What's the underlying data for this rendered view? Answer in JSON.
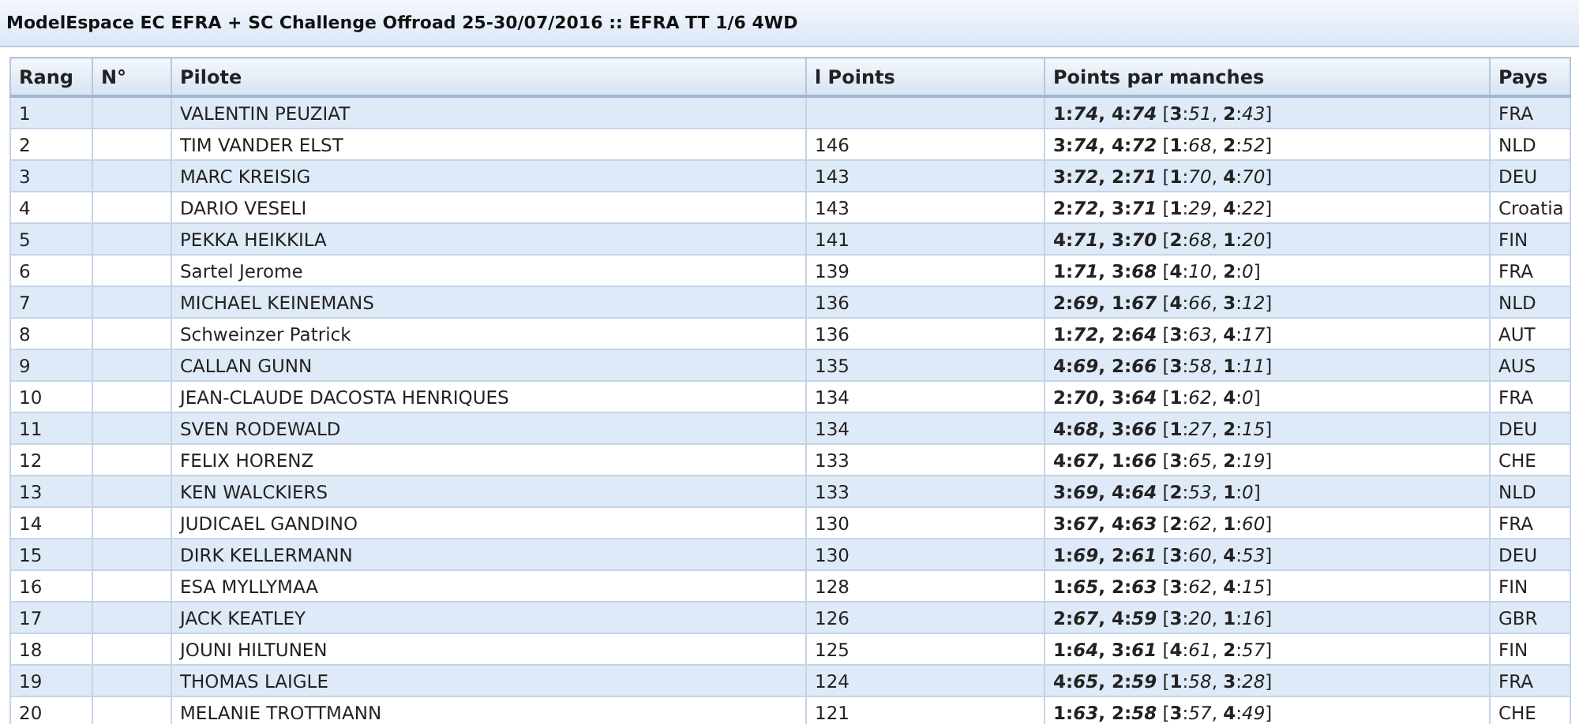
{
  "title": "ModelEspace EC EFRA + SC Challenge Offroad 25-30/07/2016 :: EFRA TT 1/6 4WD",
  "table": {
    "columns": [
      "Rang",
      "N°",
      "Pilote",
      "l Points",
      "Points par manches",
      "Pays"
    ],
    "rows": [
      {
        "rang": "1",
        "pilote": "VALENTIN PEUZIAT",
        "best": "1:*74*, 4:*74*",
        "dropped": "[**3**:*51*, **2**:*43*]",
        "pays": "FRA"
      },
      {
        "rang": "2",
        "pilote": "TIM VANDER ELST",
        "points": "146",
        "best": "3:*74*, 4:*72*",
        "dropped": "[**1**:*68*, **2**:*52*]",
        "pays": "NLD"
      },
      {
        "rang": "3",
        "pilote": "MARC KREISIG",
        "points": "143",
        "best": "3:*72*, 2:*71*",
        "dropped": "[**1**:*70*, **4**:*70*]",
        "pays": "DEU"
      },
      {
        "rang": "4",
        "pilote": "DARIO VESELI",
        "points": "143",
        "best": "2:*72*, 3:*71*",
        "dropped": "[**1**:*29*, **4**:*22*]",
        "pays": "Croatia"
      },
      {
        "rang": "5",
        "pilote": "PEKKA HEIKKILA",
        "points": "141",
        "best": "4:*71*, 3:*70*",
        "dropped": "[**2**:*68*, **1**:*20*]",
        "pays": "FIN"
      },
      {
        "rang": "6",
        "pilote": "Sartel Jerome",
        "points": "139",
        "best": "1:*71*, 3:*68*",
        "dropped": "[**4**:*10*, **2**:*0*]",
        "pays": "FRA"
      },
      {
        "rang": "7",
        "pilote": "MICHAEL KEINEMANS",
        "points": "136",
        "best": "2:*69*, 1:*67*",
        "dropped": "[**4**:*66*, **3**:*12*]",
        "pays": "NLD"
      },
      {
        "rang": "8",
        "pilote": "Schweinzer Patrick",
        "points": "136",
        "best": "1:*72*, 2:*64*",
        "dropped": "[**3**:*63*, **4**:*17*]",
        "pays": "AUT"
      },
      {
        "rang": "9",
        "pilote": "CALLAN GUNN",
        "points": "135",
        "best": "4:*69*, 2:*66*",
        "dropped": "[**3**:*58*, **1**:*11*]",
        "pays": "AUS"
      },
      {
        "rang": "10",
        "pilote": "JEAN-CLAUDE DACOSTA HENRIQUES",
        "points": "134",
        "best": "2:*70*, 3:*64*",
        "dropped": "[**1**:*62*, **4**:*0*]",
        "pays": "FRA"
      },
      {
        "rang": "11",
        "pilote": "SVEN RODEWALD",
        "points": "134",
        "best": "4:*68*, 3:*66*",
        "dropped": "[**1**:*27*, **2**:*15*]",
        "pays": "DEU"
      },
      {
        "rang": "12",
        "pilote": "FELIX HORENZ",
        "points": "133",
        "best": "4:*67*, 1:*66*",
        "dropped": "[**3**:*65*, **2**:*19*]",
        "pays": "CHE"
      },
      {
        "rang": "13",
        "pilote": "KEN WALCKIERS",
        "points": "133",
        "best": "3:*69*, 4:*64*",
        "dropped": "[**2**:*53*, **1**:*0*]",
        "pays": "NLD"
      },
      {
        "rang": "14",
        "pilote": "JUDICAEL GANDINO",
        "points": "130",
        "best": "3:*67*, 4:*63*",
        "dropped": "[**2**:*62*, **1**:*60*]",
        "pays": "FRA"
      },
      {
        "rang": "15",
        "pilote": "DIRK KELLERMANN",
        "points": "130",
        "best": "1:*69*, 2:*61*",
        "dropped": "[**3**:*60*, **4**:*53*]",
        "pays": "DEU"
      },
      {
        "rang": "16",
        "pilote": "ESA MYLLYMAA",
        "points": "128",
        "best": "1:*65*, 2:*63*",
        "dropped": "[**3**:*62*, **4**:*15*]",
        "pays": "FIN"
      },
      {
        "rang": "17",
        "pilote": "JACK KEATLEY",
        "points": "126",
        "best": "2:*67*, 4:*59*",
        "dropped": "[**3**:*20*, **1**:*16*]",
        "pays": "GBR"
      },
      {
        "rang": "18",
        "pilote": "JOUNI HILTUNEN",
        "points": "125",
        "best": "1:*64*, 3:*61*",
        "dropped": "[**4**:*61*, **2**:*57*]",
        "pays": "FIN"
      },
      {
        "rang": "19",
        "pilote": "THOMAS LAIGLE",
        "points": "124",
        "best": "4:*65*, 2:*59*",
        "dropped": "[**1**:*58*, **3**:*28*]",
        "pays": "FRA"
      },
      {
        "rang": "20",
        "pilote": "MELANIE TROTTMANN",
        "points": "121",
        "best": "1:*63*, 2:*58*",
        "dropped": "[**3**:*57*, **4**:*49*]",
        "pays": "CHE"
      }
    ]
  }
}
